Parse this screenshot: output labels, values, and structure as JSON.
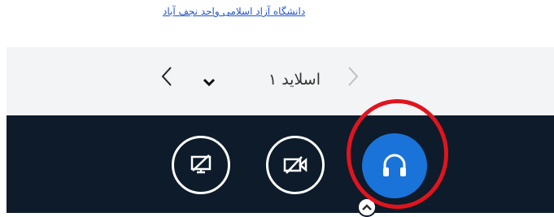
{
  "header": {
    "link_text": "دانشگاه آزاد اسلامی واحد نجف آباد"
  },
  "slide_nav": {
    "current_slide_label": "اسلاید ۱"
  },
  "controls": {
    "background_color": "#0d1b2a",
    "audio_button_color": "#1a73d9",
    "highlight_color": "#e0141e"
  },
  "icons": {
    "prev": "chevron-left-icon",
    "next": "chevron-right-icon",
    "dropdown": "chevron-down-icon",
    "screen_share": "screen-share-off-icon",
    "video": "video-off-icon",
    "audio": "headphones-icon",
    "audio_options": "chevron-up-icon"
  }
}
